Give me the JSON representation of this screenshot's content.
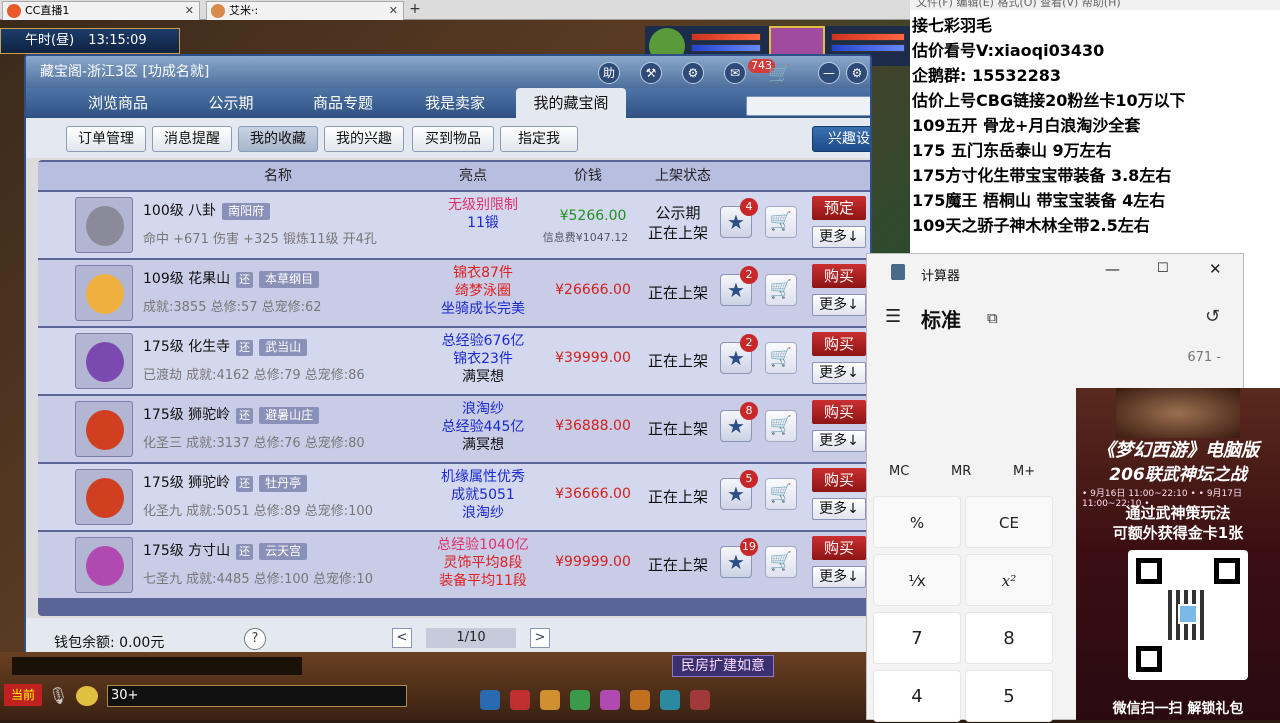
{
  "browser": {
    "tabs": [
      {
        "label": "CC直播1"
      },
      {
        "label": "艾米·:"
      }
    ],
    "new_tab": "+"
  },
  "game": {
    "time_label": "午时(昼)",
    "clock": "13:15:09",
    "chat_prefix": "当前",
    "chat_input": "30+",
    "house_button": "民房扩建如意"
  },
  "cbg": {
    "title": "藏宝阁-浙江3区 [功成名就]",
    "help_icon": "助",
    "message_count": "743",
    "tabs": [
      "浏览商品",
      "公示期",
      "商品专题",
      "我是卖家",
      "我的藏宝阁"
    ],
    "search_placeholder": "",
    "subtabs": [
      "订单管理",
      "消息提醒",
      "我的收藏",
      "我的兴趣",
      "买到物品",
      "指定我"
    ],
    "interest_settings": "兴趣设置",
    "columns": [
      "名称",
      "亮点",
      "价钱",
      "上架状态"
    ],
    "rows": [
      {
        "title": "100级 八卦",
        "tag": "南阳府",
        "huan": "",
        "sub": "命中 +671 伤害 +325 锻炼11级 开4孔",
        "highlights": [
          "无级别限制",
          "11锻"
        ],
        "hl_colors": [
          "#e0306a",
          "#1a2ad0"
        ],
        "price": "¥5266.00",
        "fee": "信息费¥1047.12",
        "status": [
          "公示期",
          "正在上架"
        ],
        "fav_count": "4",
        "action": "预定",
        "more": "更多↓"
      },
      {
        "title": "109级 花果山",
        "tag": "本草纲目",
        "huan": "还",
        "sub": "成就:3855 总修:57 总宠修:62",
        "highlights": [
          "锦衣87件",
          "绮梦泳圈",
          "坐骑成长完美"
        ],
        "hl_colors": [
          "#e02020",
          "#e02020",
          "#1a2ad0"
        ],
        "price": "¥26666.00",
        "fee": "",
        "status": [
          "正在上架"
        ],
        "fav_count": "2",
        "action": "购买",
        "more": "更多↓"
      },
      {
        "title": "175级 化生寺",
        "tag": "武当山",
        "huan": "还",
        "sub": "已渡劫 成就:4162 总修:79 总宠修:86",
        "highlights": [
          "总经验676亿",
          "锦衣23件",
          "满冥想"
        ],
        "hl_colors": [
          "#1a2ad0",
          "#1a2ad0",
          "#111111"
        ],
        "price": "¥39999.00",
        "fee": "",
        "status": [
          "正在上架"
        ],
        "fav_count": "2",
        "action": "购买",
        "more": "更多↓"
      },
      {
        "title": "175级 狮驼岭",
        "tag": "避暑山庄",
        "huan": "还",
        "sub": "化圣三 成就:3137 总修:76 总宠修:80",
        "highlights": [
          "浪淘纱",
          "总经验445亿",
          "满冥想"
        ],
        "hl_colors": [
          "#1a2ad0",
          "#1a2ad0",
          "#111111"
        ],
        "price": "¥36888.00",
        "fee": "",
        "status": [
          "正在上架"
        ],
        "fav_count": "8",
        "action": "购买",
        "more": "更多↓"
      },
      {
        "title": "175级 狮驼岭",
        "tag": "牡丹亭",
        "huan": "还",
        "sub": "化圣九 成就:5051 总修:89 总宠修:100",
        "highlights": [
          "机缘属性优秀",
          "成就5051",
          "浪淘纱"
        ],
        "hl_colors": [
          "#1a2ad0",
          "#1a2ad0",
          "#1a2ad0"
        ],
        "price": "¥36666.00",
        "fee": "",
        "status": [
          "正在上架"
        ],
        "fav_count": "5",
        "action": "购买",
        "more": "更多↓"
      },
      {
        "title": "175级 方寸山",
        "tag": "云天宫",
        "huan": "还",
        "sub": "七圣九 成就:4485 总修:100 总宠修:10",
        "highlights": [
          "总经验1040亿",
          "灵饰平均8段",
          "装备平均11段"
        ],
        "hl_colors": [
          "#e0306a",
          "#e02020",
          "#e02020"
        ],
        "price": "¥99999.00",
        "fee": "",
        "status": [
          "正在上架"
        ],
        "fav_count": "19",
        "action": "购买",
        "more": "更多↓"
      }
    ],
    "wallet": "钱包余额: 0.00元",
    "help": "?",
    "page": "1/10"
  },
  "notepad": {
    "menu": "文件(F)   编辑(E)   格式(O)   查看(V)   帮助(H)",
    "lines": [
      "      接七彩羽毛",
      "估价看号V:xiaoqi03430",
      "企鹅群: 15532283",
      "估价上号CBG链接20粉丝卡10万以下",
      "109五开 骨龙+月白浪淘沙全套",
      "175 五门东岳泰山  9万左右",
      "175方寸化生带宝宝带装备  3.8左右",
      "175魔王 梧桐山 带宝宝装备 4左右",
      "109天之骄子神木林全带2.5左右"
    ]
  },
  "calculator": {
    "title": "计算器",
    "mode": "标准",
    "history": "671 -",
    "memory": [
      "MC",
      "MR",
      "M+"
    ],
    "keys": [
      "%",
      "CE",
      "¹⁄x",
      "x²",
      "7",
      "8",
      "4",
      "5"
    ]
  },
  "promo": {
    "title": "《梦幻西游》电脑版",
    "subtitle": "206联武神坛之战",
    "dates": "• 9月16日 11:00~22:10 •   • 9月17日 11:00~22:10 •",
    "line1": "通过武神策玩法",
    "line2": "可额外获得金卡1张",
    "footer": "微信扫一扫 解锁礼包"
  }
}
